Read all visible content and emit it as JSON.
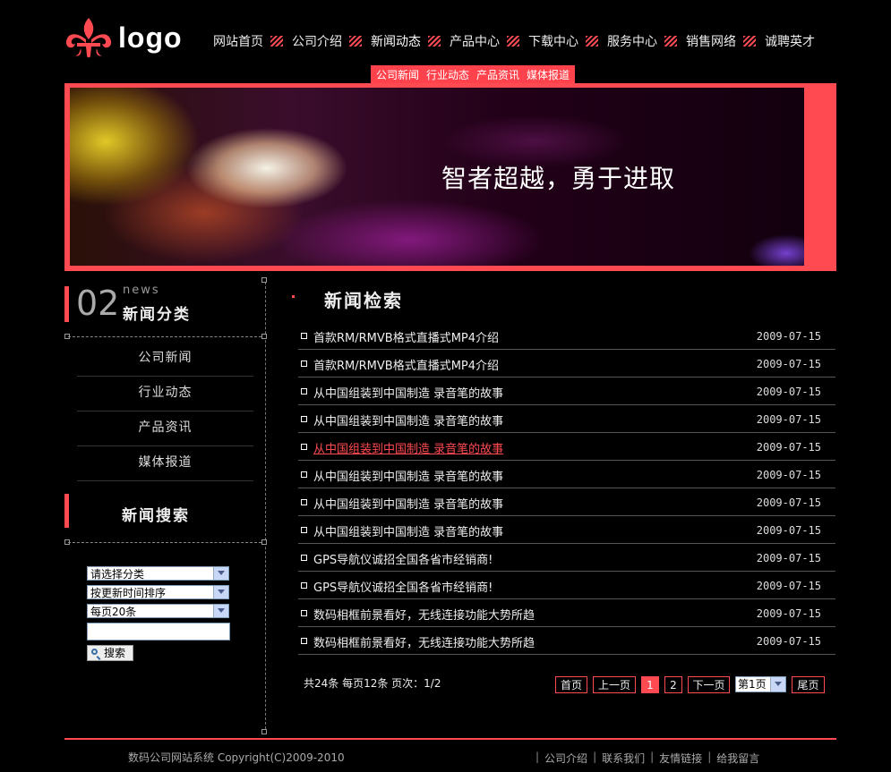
{
  "header": {
    "logo_text": "logo",
    "nav": [
      "网站首页",
      "公司介绍",
      "新闻动态",
      "产品中心",
      "下载中心",
      "服务中心",
      "销售网络",
      "诚聘英才"
    ],
    "subnav": [
      "公司新闻",
      "行业动态",
      "产品资讯",
      "媒体报道"
    ]
  },
  "banner": {
    "slogan": "智者超越，勇于进取"
  },
  "sidebar": {
    "category_number": "02",
    "category_en": "news",
    "category_title": "新闻分类",
    "categories": [
      "公司新闻",
      "行业动态",
      "产品资讯",
      "媒体报道"
    ],
    "search_title": "新闻搜索",
    "select_category": "请选择分类",
    "select_sort": "按更新时间排序",
    "select_per_page": "每页20条",
    "search_button": "搜索"
  },
  "main": {
    "title": "新闻检索",
    "news": [
      {
        "title": "首款RM/RMVB格式直播式MP4介绍",
        "date": "2009-07-15"
      },
      {
        "title": "首款RM/RMVB格式直播式MP4介绍",
        "date": "2009-07-15"
      },
      {
        "title": "从中国组装到中国制造 录音笔的故事",
        "date": "2009-07-15"
      },
      {
        "title": "从中国组装到中国制造 录音笔的故事",
        "date": "2009-07-15"
      },
      {
        "title": "从中国组装到中国制造 录音笔的故事",
        "date": "2009-07-15"
      },
      {
        "title": "从中国组装到中国制造 录音笔的故事",
        "date": "2009-07-15"
      },
      {
        "title": "从中国组装到中国制造 录音笔的故事",
        "date": "2009-07-15"
      },
      {
        "title": "从中国组装到中国制造 录音笔的故事",
        "date": "2009-07-15"
      },
      {
        "title": "GPS导航仪诚招全国各省市经销商!",
        "date": "2009-07-15"
      },
      {
        "title": "GPS导航仪诚招全国各省市经销商!",
        "date": "2009-07-15"
      },
      {
        "title": "数码相框前景看好，无线连接功能大势所趋",
        "date": "2009-07-15"
      },
      {
        "title": "数码相框前景看好，无线连接功能大势所趋",
        "date": "2009-07-15"
      }
    ],
    "pagination": {
      "info": "共24条 每页12条 页次：1/2",
      "first": "首页",
      "prev": "上一页",
      "page1": "1",
      "page2": "2",
      "next": "下一页",
      "page_select": "第1页",
      "last": "尾页"
    }
  },
  "footer": {
    "copyright": "数码公司网站系统 Copyright(C)2009-2010",
    "links": [
      "公司介绍",
      "联系我们",
      "友情链接",
      "给我留言"
    ]
  },
  "colors": {
    "accent": "#ff4a52",
    "background": "#000000"
  }
}
